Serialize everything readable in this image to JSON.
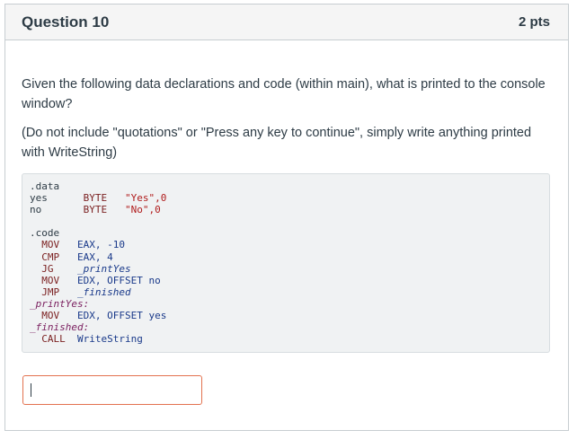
{
  "question": {
    "title": "Question 10",
    "points": "2 pts"
  },
  "prompt": {
    "line1": "Given the following data declarations and code (within main), what is printed to the console window?",
    "line2": "(Do not include \"quotations\" or \"Press any key to continue\", simply write anything printed with WriteString)"
  },
  "code": {
    "data_directive": ".data",
    "yes_decl": {
      "label": "yes",
      "type": "BYTE",
      "value": "\"Yes\",0"
    },
    "no_decl": {
      "label": "no",
      "type": "BYTE",
      "value": "\"No\",0"
    },
    "code_directive": ".code",
    "instructions_a": [
      {
        "op": "MOV",
        "args": "EAX, -10"
      },
      {
        "op": "CMP",
        "args": "EAX, 4"
      },
      {
        "op": "JG",
        "args": "_printYes"
      },
      {
        "op": "MOV",
        "args": "EDX, OFFSET no"
      },
      {
        "op": "JMP",
        "args": "_finished"
      }
    ],
    "label_printYes": "_printYes:",
    "instruction_b": {
      "op": "MOV",
      "args": "EDX, OFFSET yes"
    },
    "label_finished": "_finished:",
    "instruction_c": {
      "op": "CALL",
      "args": "WriteString"
    }
  },
  "answer": {
    "value": "",
    "placeholder": ""
  },
  "colors": {
    "header_bg": "#f5f5f5",
    "border": "#c7cdd1",
    "code_bg": "#f0f2f3",
    "answer_border": "#e3724f",
    "text": "#2d3b45"
  }
}
